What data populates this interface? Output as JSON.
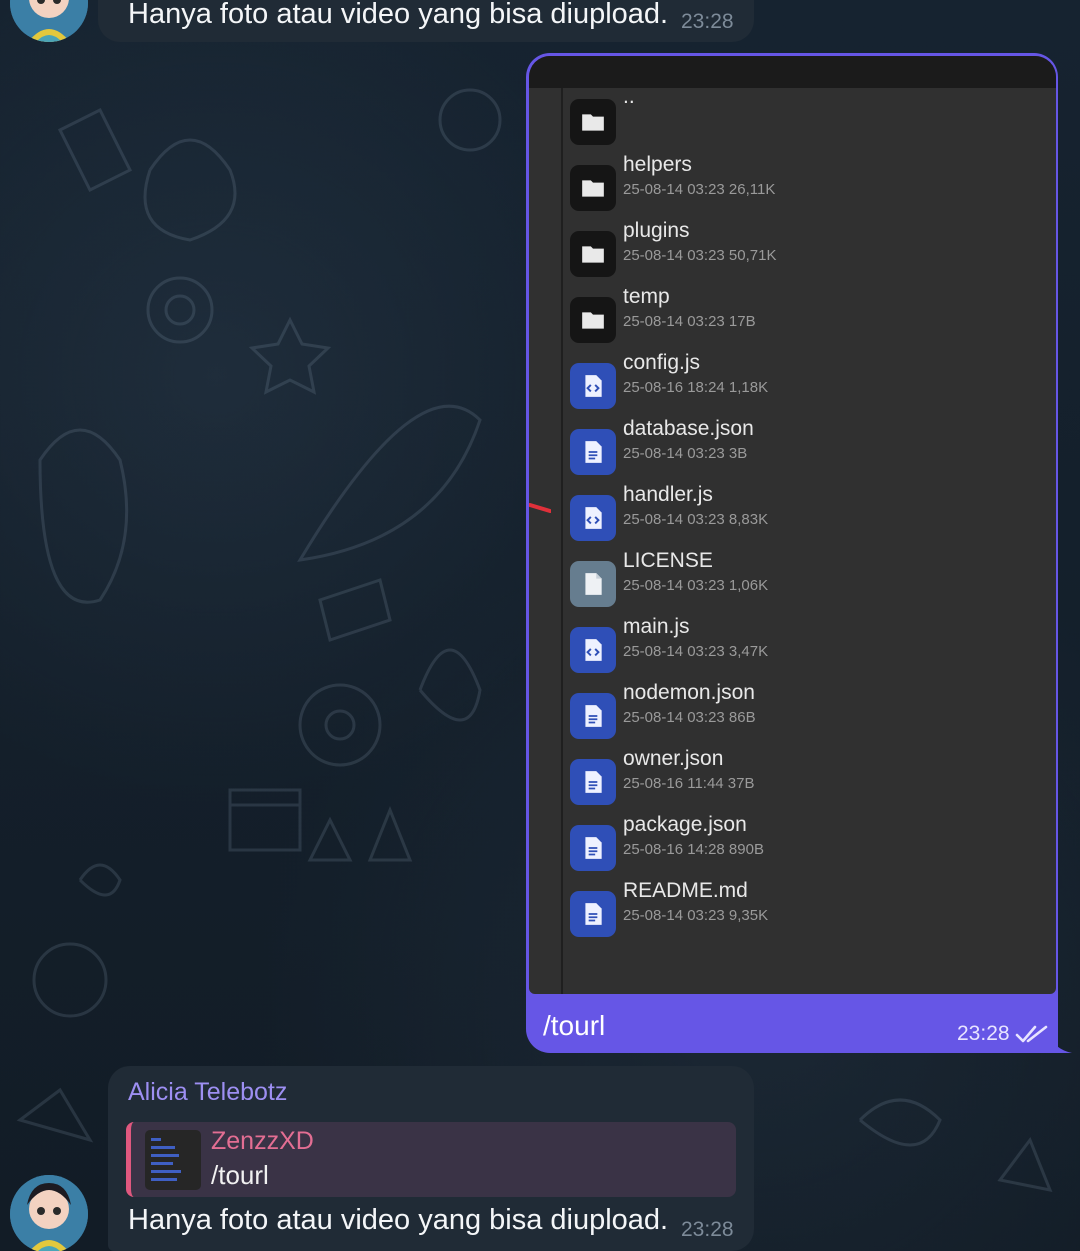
{
  "chat": {
    "prev_message": {
      "text": "Hanya foto atau video yang bisa diupload.",
      "time": "23:28"
    },
    "outgoing": {
      "caption": "/tourl",
      "time": "23:28",
      "status_icon": "double-check-icon",
      "screenshot_files": [
        {
          "name": "..",
          "meta": "",
          "icon": "folder-icon"
        },
        {
          "name": "helpers",
          "meta": "25-08-14 03:23  26,11K",
          "icon": "folder-icon"
        },
        {
          "name": "plugins",
          "meta": "25-08-14 03:23  50,71K",
          "icon": "folder-icon"
        },
        {
          "name": "temp",
          "meta": "25-08-14 03:23  17B",
          "icon": "folder-icon"
        },
        {
          "name": "config.js",
          "meta": "25-08-16 18:24  1,18K",
          "icon": "code-file-icon"
        },
        {
          "name": "database.json",
          "meta": "25-08-14 03:23  3B",
          "icon": "document-file-icon"
        },
        {
          "name": "handler.js",
          "meta": "25-08-14 03:23  8,83K",
          "icon": "code-file-icon"
        },
        {
          "name": "LICENSE",
          "meta": "25-08-14 03:23  1,06K",
          "icon": "plain-file-icon"
        },
        {
          "name": "main.js",
          "meta": "25-08-14 03:23  3,47K",
          "icon": "code-file-icon"
        },
        {
          "name": "nodemon.json",
          "meta": "25-08-14 03:23  86B",
          "icon": "document-file-icon"
        },
        {
          "name": "owner.json",
          "meta": "25-08-16 11:44  37B",
          "icon": "document-file-icon"
        },
        {
          "name": "package.json",
          "meta": "25-08-16 14:28  890B",
          "icon": "document-file-icon"
        },
        {
          "name": "README.md",
          "meta": "25-08-14 03:23  9,35K",
          "icon": "document-file-icon"
        }
      ]
    },
    "reply_message": {
      "sender": "Alicia Telebotz",
      "quoted_sender": "ZenzzXD",
      "quoted_text": "/tourl",
      "text": "Hanya foto atau video yang bisa diupload.",
      "time": "23:28"
    }
  },
  "colors": {
    "background": "#15202b",
    "incoming_bubble": "#202b36",
    "outgoing_bubble": "#6656e6",
    "sender_name": "#9d8ff2",
    "quoted_name": "#e36e93"
  }
}
